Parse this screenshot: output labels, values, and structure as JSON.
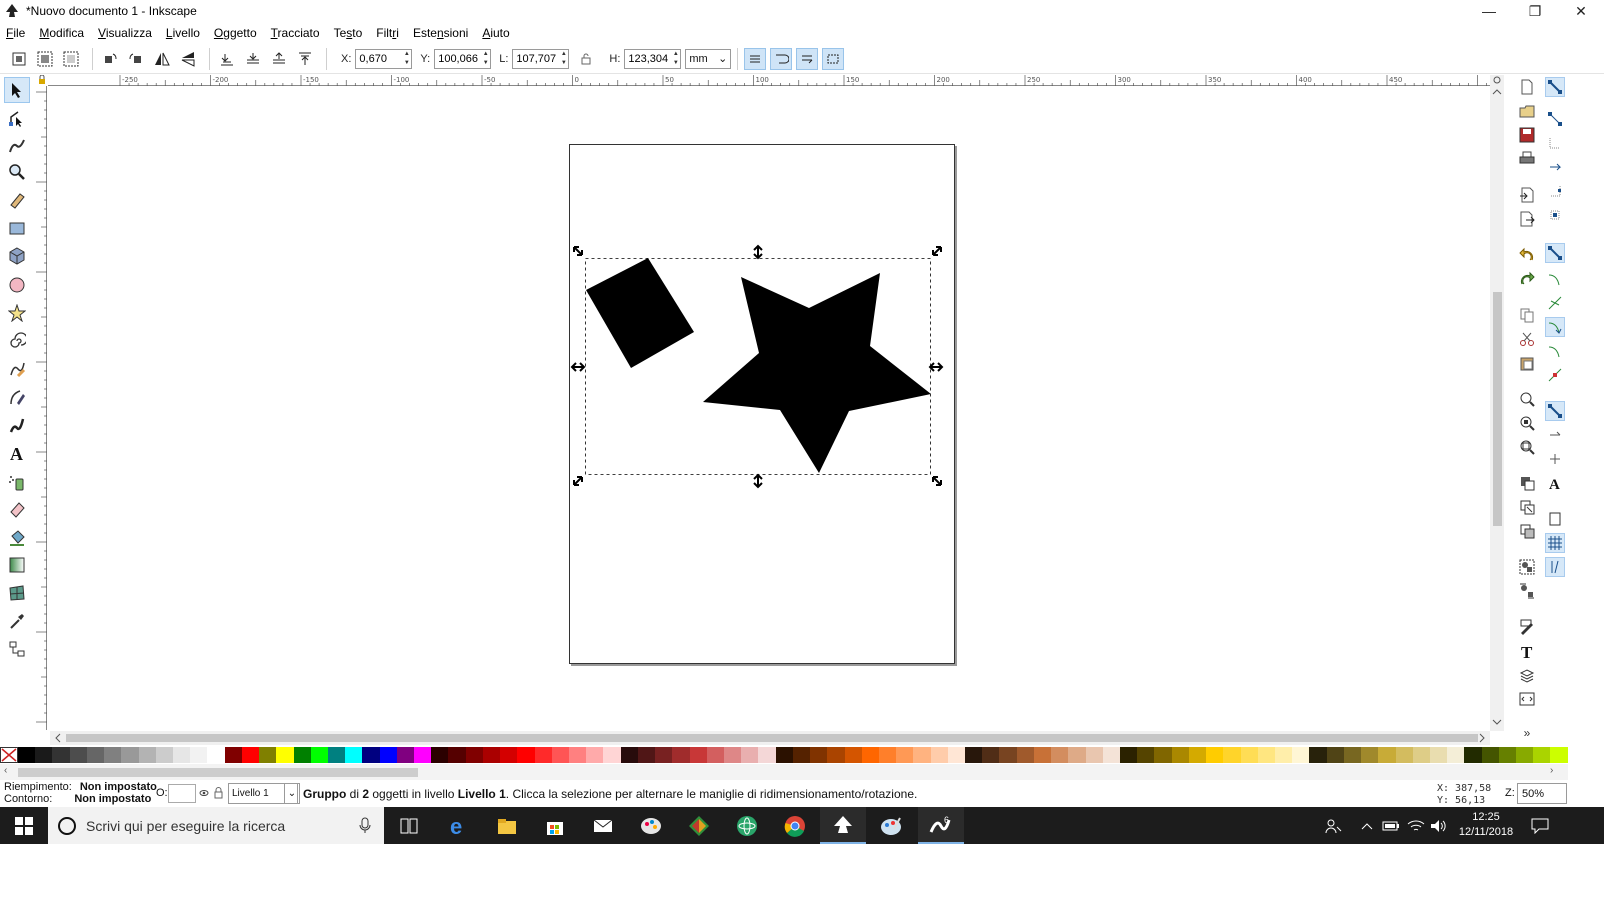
{
  "window": {
    "title": "*Nuovo documento 1 - Inkscape"
  },
  "menu": [
    {
      "label": "File",
      "ul": "F"
    },
    {
      "label": "Modifica",
      "ul": "M"
    },
    {
      "label": "Visualizza",
      "ul": "V"
    },
    {
      "label": "Livello",
      "ul": "L"
    },
    {
      "label": "Oggetto",
      "ul": "O"
    },
    {
      "label": "Tracciato",
      "ul": "T"
    },
    {
      "label": "Testo",
      "ul": "s"
    },
    {
      "label": "Filtri",
      "ul": "r"
    },
    {
      "label": "Estensioni",
      "ul": "n"
    },
    {
      "label": "Aiuto",
      "ul": "A"
    }
  ],
  "controls": {
    "x_label": "X:",
    "x_value": "0,670",
    "y_label": "Y:",
    "y_value": "100,066",
    "w_label": "L:",
    "w_value": "107,707",
    "h_label": "H:",
    "h_value": "123,304",
    "unit": "mm"
  },
  "ruler_labels": [
    "-250",
    "-200",
    "-150",
    "-100",
    "-50",
    "0",
    "50",
    "100",
    "150",
    "200",
    "250",
    "300",
    "350",
    "400",
    "450"
  ],
  "status": {
    "fill_label": "Riempimento:",
    "fill_value": "Non impostato",
    "stroke_label": "Contorno:",
    "stroke_value": "Non impostato",
    "opacity_label": "O:",
    "layer": "Livello 1",
    "msg_bold1": "Gruppo",
    "msg_mid1": " di ",
    "msg_bold2": "2",
    "msg_mid2": " oggetti in livello ",
    "msg_bold3": "Livello 1",
    "msg_end": ". Clicca la selezione per alternare le maniglie di ridimensionamento/rotazione.",
    "x_coord": "X: 387,58",
    "y_coord": "Y:  56,13",
    "zoom_label": "Z:",
    "zoom_value": "50%"
  },
  "taskbar": {
    "search_placeholder": "Scrivi qui per eseguire la ricerca",
    "time": "12:25",
    "date": "12/11/2018"
  },
  "colors": {
    "selection": "#000000",
    "page_border": "#333333",
    "taskbar_bg": "#1c1c1c",
    "active_tool": "#d6e8f8"
  }
}
